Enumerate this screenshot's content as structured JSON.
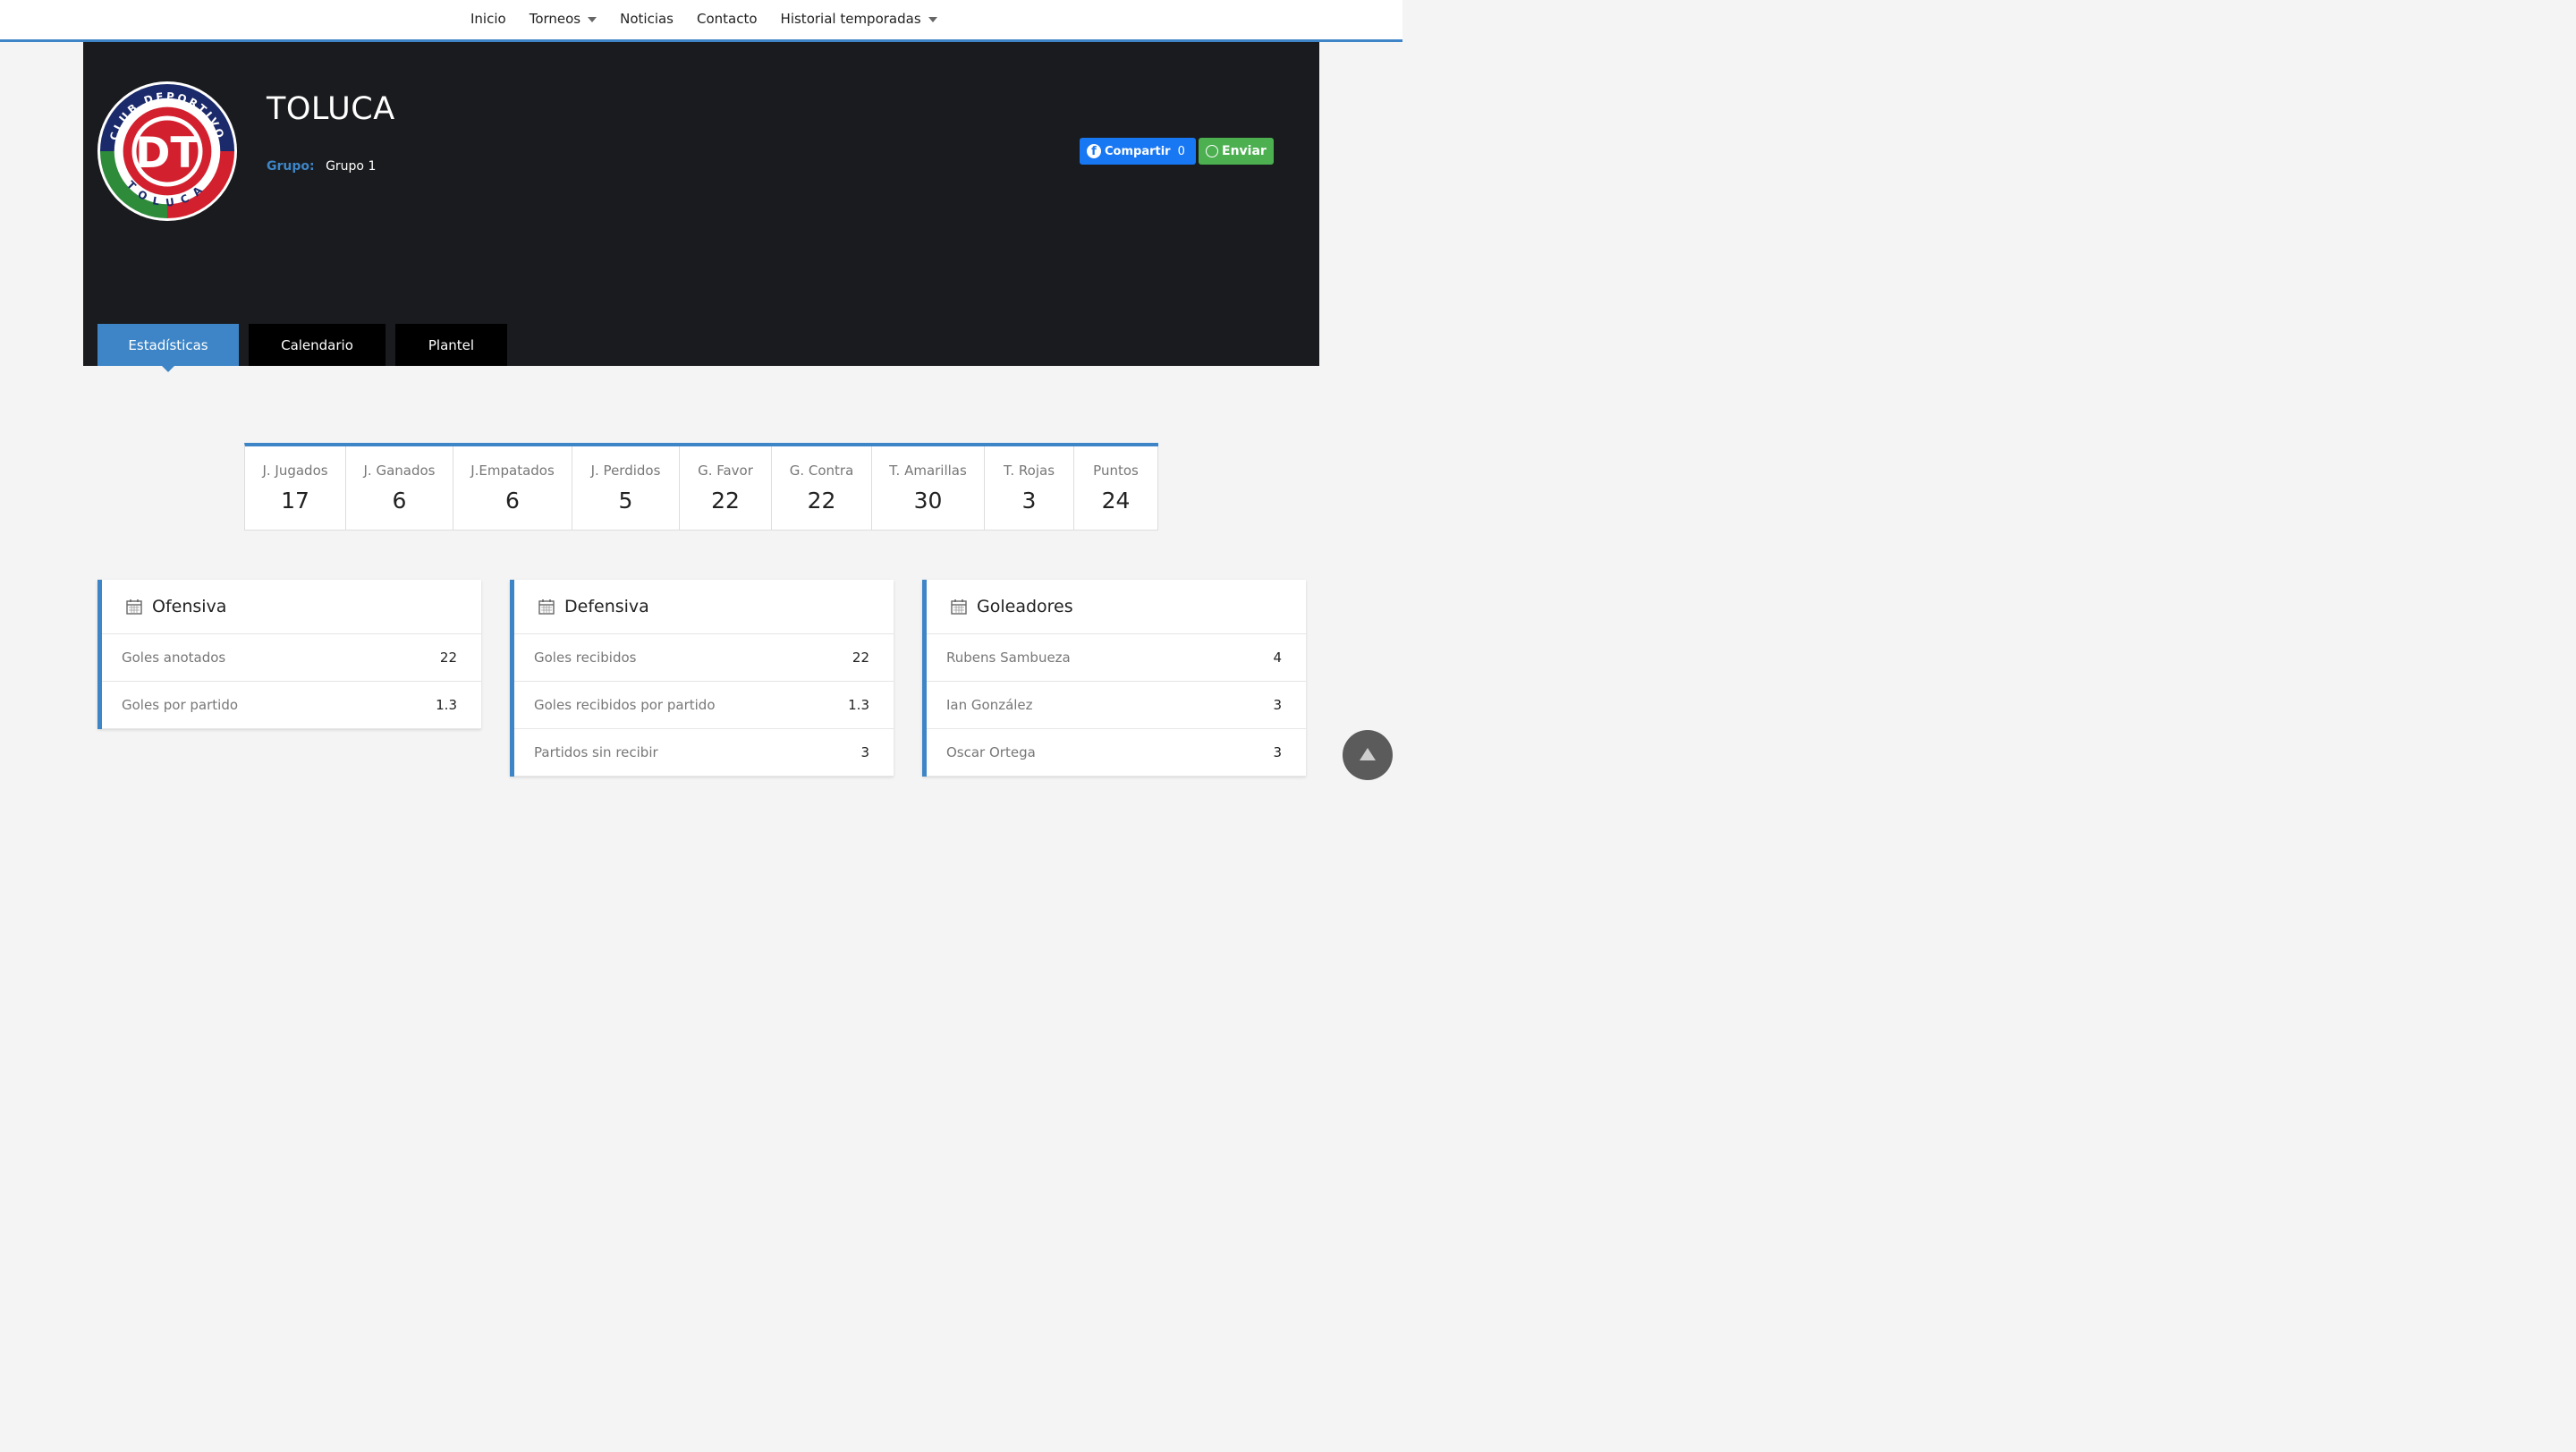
{
  "nav": {
    "items": [
      {
        "label": "Inicio",
        "dropdown": false
      },
      {
        "label": "Torneos",
        "dropdown": true
      },
      {
        "label": "Noticias",
        "dropdown": false
      },
      {
        "label": "Contacto",
        "dropdown": false
      },
      {
        "label": "Historial temporadas",
        "dropdown": true
      }
    ]
  },
  "team": {
    "name": "TOLUCA",
    "group_label": "Grupo:",
    "group_value": "Grupo 1",
    "logo_text_top": "CLUB DEPORTIVO",
    "logo_text_bottom": "TOLUCA",
    "logo_monogram": "DT"
  },
  "share": {
    "facebook_label": "Compartir",
    "facebook_count": "0",
    "whatsapp_label": "Enviar"
  },
  "tabs": [
    {
      "label": "Estadísticas",
      "active": true
    },
    {
      "label": "Calendario",
      "active": false
    },
    {
      "label": "Plantel",
      "active": false
    }
  ],
  "stats": [
    {
      "label": "J. Jugados",
      "value": "17"
    },
    {
      "label": "J. Ganados",
      "value": "6"
    },
    {
      "label": "J.Empatados",
      "value": "6"
    },
    {
      "label": "J. Perdidos",
      "value": "5"
    },
    {
      "label": "G. Favor",
      "value": "22"
    },
    {
      "label": "G. Contra",
      "value": "22"
    },
    {
      "label": "T. Amarillas",
      "value": "30"
    },
    {
      "label": "T. Rojas",
      "value": "3"
    },
    {
      "label": "Puntos",
      "value": "24"
    }
  ],
  "cards": {
    "ofensiva": {
      "title": "Ofensiva",
      "rows": [
        {
          "label": "Goles anotados",
          "value": "22"
        },
        {
          "label": "Goles por partido",
          "value": "1.3"
        }
      ]
    },
    "defensiva": {
      "title": "Defensiva",
      "rows": [
        {
          "label": "Goles recibidos",
          "value": "22"
        },
        {
          "label": "Goles recibidos por partido",
          "value": "1.3"
        },
        {
          "label": "Partidos sin recibir",
          "value": "3"
        }
      ]
    },
    "goleadores": {
      "title": "Goleadores",
      "rows": [
        {
          "label": "Rubens Sambueza",
          "value": "4"
        },
        {
          "label": "Ian González",
          "value": "3"
        },
        {
          "label": "Oscar Ortega",
          "value": "3"
        }
      ]
    }
  },
  "colors": {
    "accent": "#3d85c6",
    "header_bg": "#1a1b1e",
    "facebook": "#1877f2",
    "whatsapp": "#4caf50",
    "logo_red": "#d3202e",
    "logo_navy": "#1b2a6b",
    "logo_green": "#2e8b3a"
  }
}
